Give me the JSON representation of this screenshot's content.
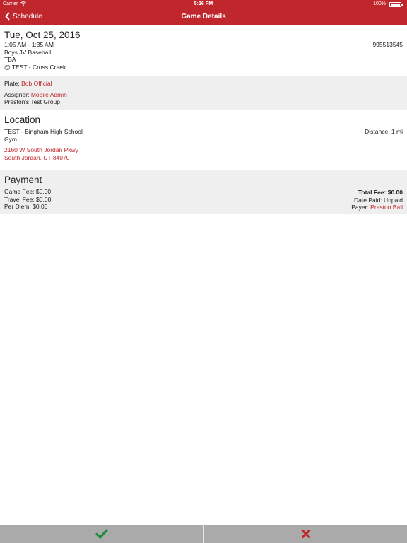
{
  "status_bar": {
    "carrier": "Carrier",
    "time": "5:26 PM",
    "battery": "100%"
  },
  "nav": {
    "back_label": "Schedule",
    "title": "Game Details"
  },
  "game": {
    "date": "Tue, Oct 25, 2016",
    "time_range": "1:05 AM - 1:35 AM",
    "level": "Boys JV Baseball",
    "field": "TBA",
    "matchup": "@ TEST - Cross Creek",
    "game_id": "995513545"
  },
  "officials": {
    "plate_label": "Plate:",
    "plate_name": "Bob Official",
    "assigner_label": "Assigner:",
    "assigner_name": "Mobile Admin",
    "group": "Preston's Test Group"
  },
  "location": {
    "heading": "Location",
    "venue": "TEST - Bingham High School",
    "venue_sub": "Gym",
    "distance": "Distance: 1 mi",
    "address_line1": "2160 W South Jordan Pkwy",
    "address_line2": "South Jordan, UT 84070"
  },
  "payment": {
    "heading": "Payment",
    "game_fee": "Game Fee: $0.00",
    "travel_fee": "Travel Fee: $0.00",
    "per_diem": "Per Diem: $0.00",
    "total_fee": "Total Fee: $0.00",
    "date_paid": "Date Paid: Unpaid",
    "payer_label": "Payer:",
    "payer_name": "Preston Ball"
  },
  "actions": {
    "accept_icon": "checkmark-icon",
    "decline_icon": "x-icon",
    "accept_color": "#1e8a3c",
    "decline_color": "#c0272d"
  },
  "colors": {
    "brand": "#c0272d",
    "section_bg": "#efefef",
    "bottom_bar": "#aaaaaa"
  }
}
